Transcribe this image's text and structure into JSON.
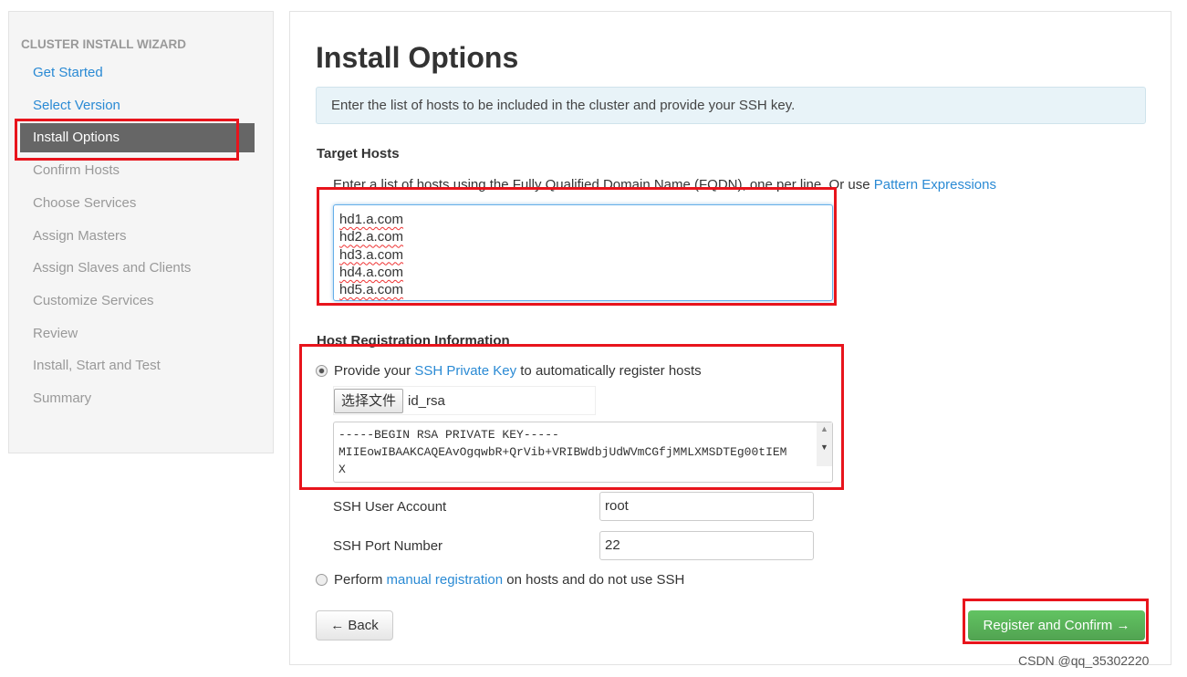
{
  "sidebar": {
    "heading": "CLUSTER INSTALL WIZARD",
    "items": [
      {
        "label": "Get Started",
        "state": "link"
      },
      {
        "label": "Select Version",
        "state": "link"
      },
      {
        "label": "Install Options",
        "state": "active"
      },
      {
        "label": "Confirm Hosts",
        "state": "disabled"
      },
      {
        "label": "Choose Services",
        "state": "disabled"
      },
      {
        "label": "Assign Masters",
        "state": "disabled"
      },
      {
        "label": "Assign Slaves and Clients",
        "state": "disabled"
      },
      {
        "label": "Customize Services",
        "state": "disabled"
      },
      {
        "label": "Review",
        "state": "disabled"
      },
      {
        "label": "Install, Start and Test",
        "state": "disabled"
      },
      {
        "label": "Summary",
        "state": "disabled"
      }
    ]
  },
  "main": {
    "title": "Install Options",
    "alert": "Enter the list of hosts to be included in the cluster and provide your SSH key.",
    "target_hosts": {
      "label": "Target Hosts",
      "help_prefix": "Enter a list of hosts using the Fully Qualified Domain Name (FQDN), one per line. Or use ",
      "help_link": "Pattern Expressions",
      "hosts": [
        "hd1.a.com",
        "hd2.a.com",
        "hd3.a.com",
        "hd4.a.com",
        "hd5.a.com"
      ]
    },
    "registration": {
      "label": "Host Registration Information",
      "ssh_option": {
        "prefix": "Provide your ",
        "link": "SSH Private Key",
        "suffix": " to automatically register hosts",
        "selected": true
      },
      "file_button": "选择文件",
      "file_name": "id_rsa",
      "key_lines": [
        "-----BEGIN RSA PRIVATE KEY-----",
        "MIIEowIBAAKCAQEAvOgqwbR+QrVib+VRIBWdbjUdWVmCGfjMMLXMSDTEg00tIEM",
        "X"
      ],
      "ssh_user_label": "SSH User Account",
      "ssh_user_value": "root",
      "ssh_port_label": "SSH Port Number",
      "ssh_port_value": "22",
      "manual_option": {
        "prefix": "Perform ",
        "link": "manual registration",
        "suffix": " on hosts and do not use SSH",
        "selected": false
      }
    },
    "back_button": "← Back",
    "confirm_button": "Register and Confirm →"
  },
  "watermark": "CSDN @qq_35302220",
  "colors": {
    "link": "#2a8ad4",
    "active_nav": "#666666",
    "primary_button": "#5cb85c",
    "highlight_box": "#e8141c"
  }
}
